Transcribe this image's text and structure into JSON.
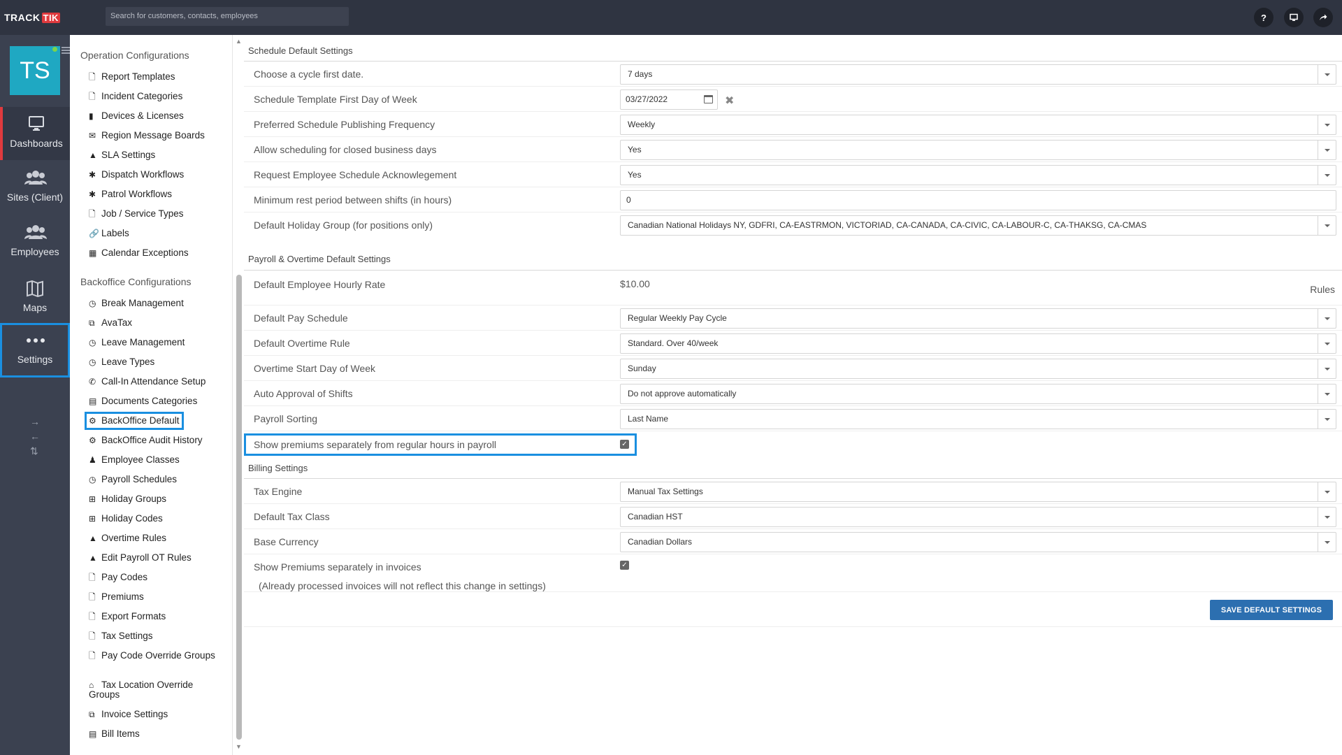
{
  "brand": {
    "logo_track": "TRACK",
    "logo_tik": "TIK"
  },
  "search": {
    "placeholder": "Search for customers, contacts, employees"
  },
  "top_icons": {
    "help": "?",
    "monitor": "▭",
    "share": "➦"
  },
  "user": {
    "initials": "TS"
  },
  "leftnav": {
    "items": [
      {
        "label": "Dashboards",
        "icon": "monitor-icon"
      },
      {
        "label": "Sites (Client)",
        "icon": "sites-icon"
      },
      {
        "label": "Employees",
        "icon": "employees-icon"
      },
      {
        "label": "Maps",
        "icon": "map-icon"
      },
      {
        "label": "Settings",
        "icon": "more-icon"
      }
    ],
    "arrows": [
      "→",
      "←",
      "⇅"
    ]
  },
  "config": {
    "operation_title": "Operation Configurations",
    "operation_items": [
      "Report Templates",
      "Incident Categories",
      "Devices & Licenses",
      "Region Message Boards",
      "SLA Settings",
      "Dispatch Workflows",
      "Patrol Workflows",
      "Job / Service Types",
      "Labels",
      "Calendar Exceptions"
    ],
    "backoffice_title": "Backoffice Configurations",
    "backoffice_items": [
      "Break Management",
      "AvaTax",
      "Leave Management",
      "Leave Types",
      "Call-In Attendance Setup",
      "Documents Categories",
      "BackOffice Default",
      "BackOffice Audit History",
      "Employee Classes",
      "Payroll Schedules",
      "Holiday Groups",
      "Holiday Codes",
      "Overtime Rules",
      "Edit Payroll OT Rules",
      "Pay Codes",
      "Premiums",
      "Export Formats",
      "Tax Settings",
      "Pay Code Override Groups",
      "Tax Location Override Groups",
      "Invoice Settings",
      "Bill Items"
    ]
  },
  "schedule": {
    "title": "Schedule Default Settings",
    "cycle_label": "Choose a cycle first date.",
    "cycle_value": "7 days",
    "template_label": "Schedule Template First Day of Week",
    "template_value": "03/27/2022",
    "publish_label": "Preferred Schedule Publishing Frequency",
    "publish_value": "Weekly",
    "closed_label": "Allow scheduling for closed business days",
    "closed_value": "Yes",
    "ack_label": "Request Employee Schedule Acknowlegement",
    "ack_value": "Yes",
    "rest_label": "Minimum rest period between shifts (in hours)",
    "rest_value": "0",
    "holiday_label": "Default Holiday Group (for positions only)",
    "holiday_value": "Canadian National Holidays NY, GDFRI, CA-EASTRMON, VICTORIAD, CA-CANADA, CA-CIVIC, CA-LABOUR-C, CA-THAKSG, CA-CMAS"
  },
  "payroll": {
    "title": "Payroll & Overtime Default Settings",
    "rate_label": "Default Employee Hourly Rate",
    "rate_value": "$10.00",
    "rules_link": "Rules",
    "pay_schedule_label": "Default Pay Schedule",
    "pay_schedule_value": "Regular Weekly Pay Cycle",
    "ot_rule_label": "Default Overtime Rule",
    "ot_rule_value": "Standard. Over 40/week",
    "ot_start_label": "Overtime Start Day of Week",
    "ot_start_value": "Sunday",
    "approval_label": "Auto Approval of Shifts",
    "approval_value": "Do not approve automatically",
    "sorting_label": "Payroll Sorting",
    "sorting_value": "Last Name",
    "premiums_label": "Show premiums separately from regular hours in payroll"
  },
  "billing": {
    "title": "Billing Settings",
    "tax_engine_label": "Tax Engine",
    "tax_engine_value": "Manual Tax Settings",
    "tax_class_label": "Default Tax Class",
    "tax_class_value": "Canadian HST",
    "currency_label": "Base Currency",
    "currency_value": "Canadian Dollars",
    "premiums_invoice_label": "Show Premiums separately in invoices",
    "premiums_invoice_note": "(Already processed invoices will not reflect this change in settings)"
  },
  "actions": {
    "save_label": "SAVE DEFAULT SETTINGS"
  },
  "colors": {
    "topbar": "#2f3441",
    "leftnav": "#3b4150",
    "accent_red": "#e03a3e",
    "avatar": "#1fa8c2",
    "highlight": "#1a8fe0",
    "save_button": "#2c6fb0"
  }
}
